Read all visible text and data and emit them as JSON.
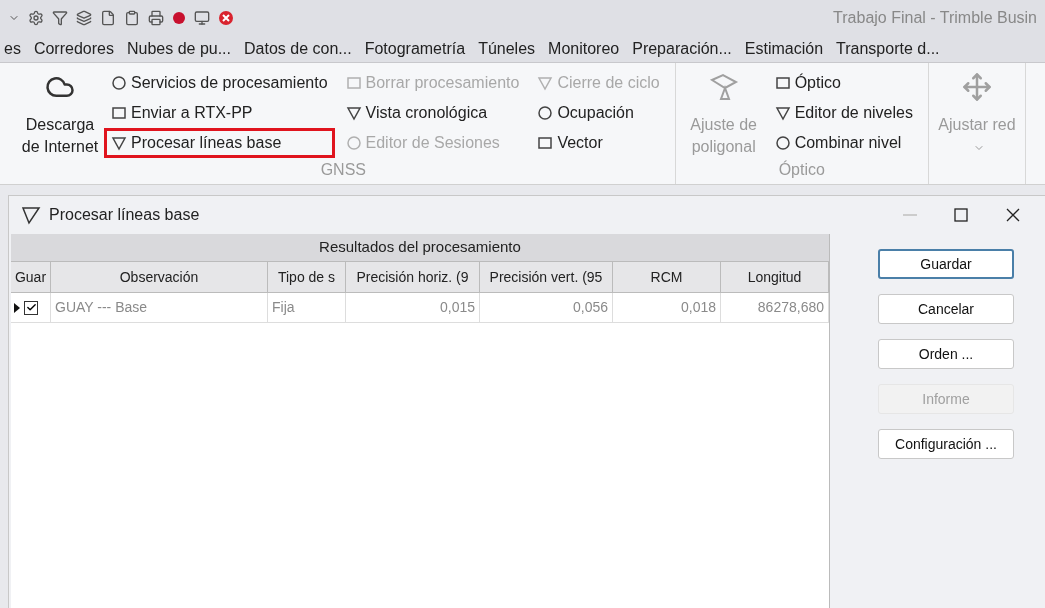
{
  "app_title": "Trabajo Final - Trimble Busin",
  "menu_tabs": [
    "es",
    "Corredores",
    "Nubes de pu...",
    "Datos de con...",
    "Fotogrametría",
    "Túneles",
    "Monitoreo",
    "Preparación...",
    "Estimación",
    "Transporte d..."
  ],
  "ribbon": {
    "groups": [
      {
        "label": "GNSS",
        "large": {
          "label": "Descarga de Internet",
          "disabled": false,
          "dropdown": false
        },
        "columns": [
          [
            {
              "label": "Servicios de procesamiento",
              "disabled": false,
              "highlighted": false
            },
            {
              "label": "Enviar a RTX-PP",
              "disabled": false,
              "highlighted": false
            },
            {
              "label": "Procesar líneas base",
              "disabled": false,
              "highlighted": true
            }
          ],
          [
            {
              "label": "Borrar procesamiento",
              "disabled": true,
              "highlighted": false
            },
            {
              "label": "Vista cronológica",
              "disabled": false,
              "highlighted": false
            },
            {
              "label": "Editor de Sesiones",
              "disabled": true,
              "highlighted": false
            }
          ],
          [
            {
              "label": "Cierre de ciclo",
              "disabled": true,
              "highlighted": false
            },
            {
              "label": "Ocupación",
              "disabled": false,
              "highlighted": false
            },
            {
              "label": "Vector",
              "disabled": false,
              "highlighted": false
            }
          ]
        ]
      },
      {
        "label": "Óptico",
        "large": {
          "label": "Ajuste de poligonal",
          "disabled": true,
          "dropdown": false
        },
        "columns": [
          [
            {
              "label": "Óptico",
              "disabled": false,
              "highlighted": false
            },
            {
              "label": "Editor de niveles",
              "disabled": false,
              "highlighted": false
            },
            {
              "label": "Combinar nivel",
              "disabled": false,
              "highlighted": false
            }
          ]
        ]
      },
      {
        "large": {
          "label": "Ajustar red",
          "disabled": true,
          "dropdown": true
        }
      }
    ]
  },
  "dialog": {
    "title": "Procesar líneas base",
    "table": {
      "group_header": "Resultados del procesamiento",
      "check_column": "Guar",
      "columns": [
        "Observación",
        "Tipo de s",
        "Precisión horiz. (9",
        "Precisión vert. (95",
        "RCM",
        "Longitud"
      ],
      "rows": [
        {
          "selected": true,
          "checked": true,
          "cells": [
            "GUAY --- Base",
            "Fija",
            "0,015",
            "0,056",
            "0,018",
            "86278,680"
          ]
        }
      ]
    },
    "buttons": [
      {
        "label": "Guardar",
        "disabled": false,
        "default": true
      },
      {
        "label": "Cancelar",
        "disabled": false,
        "default": false
      },
      {
        "label": "Orden ...",
        "disabled": false,
        "default": false
      },
      {
        "label": "Informe",
        "disabled": true,
        "default": false
      },
      {
        "label": "Configuración ...",
        "disabled": false,
        "default": false
      }
    ]
  }
}
